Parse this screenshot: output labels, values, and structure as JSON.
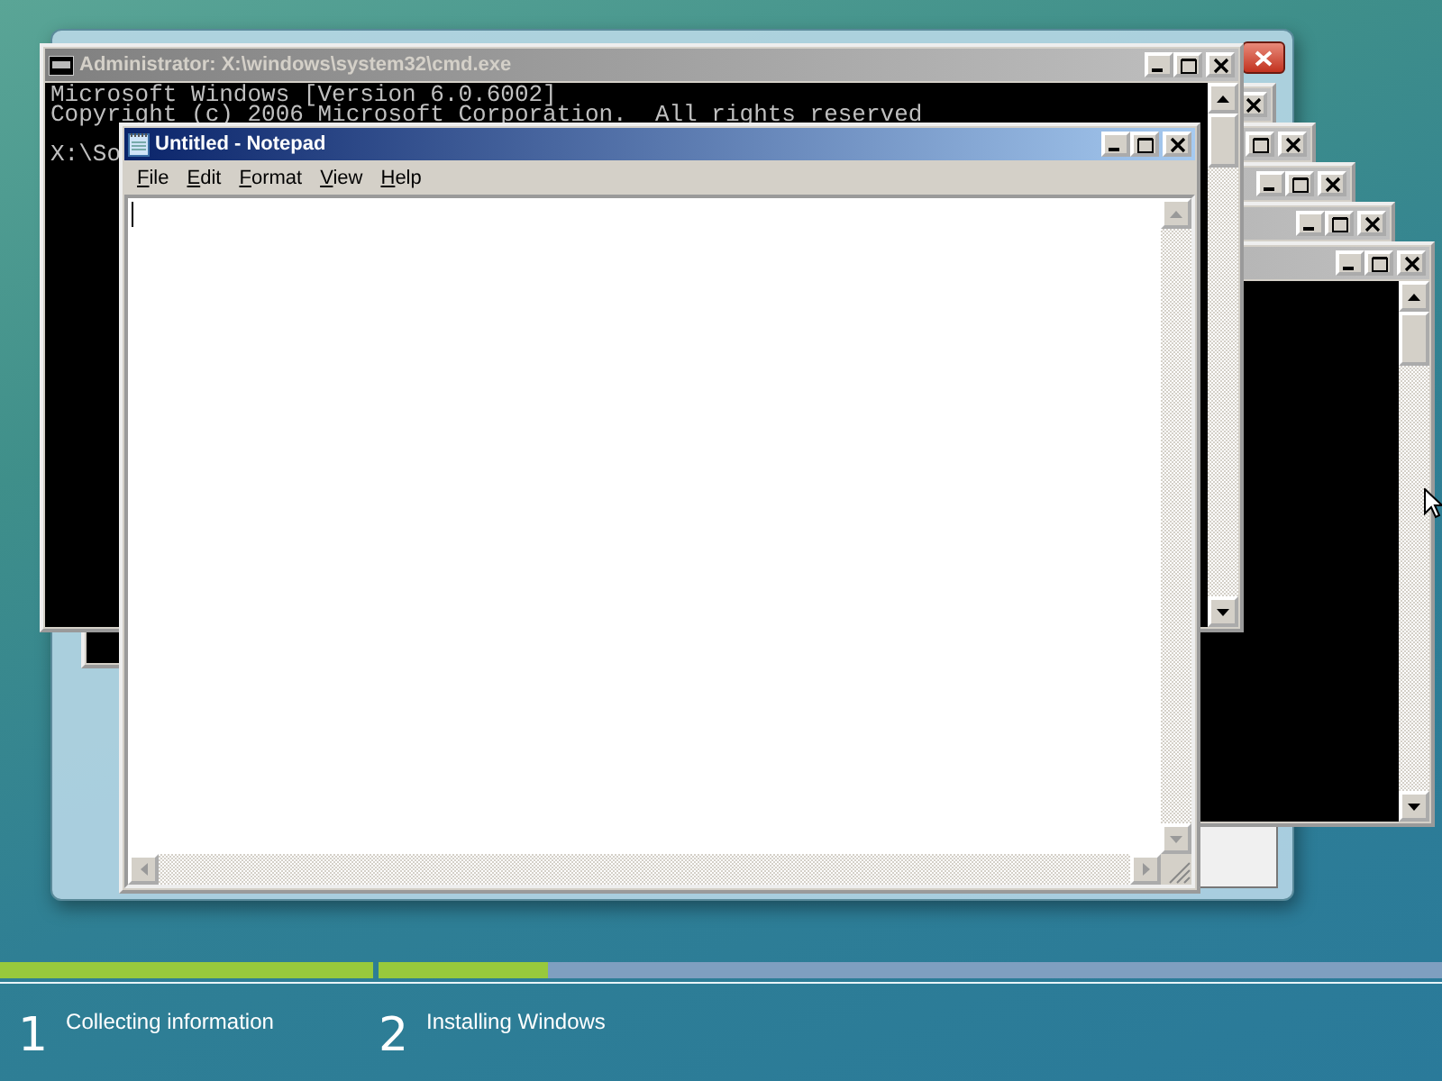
{
  "command_window": {
    "title": "Administrator: X:\\windows\\system32\\cmd.exe",
    "lines": [
      "Microsoft Windows [Version 6.0.6002]",
      "Copyright (c) 2006 Microsoft Corporation.  All rights reserved",
      "X:\\So"
    ]
  },
  "notepad": {
    "title": "Untitled - Notepad",
    "menu": [
      {
        "label": "File"
      },
      {
        "label": "Edit"
      },
      {
        "label": "Format"
      },
      {
        "label": "View"
      },
      {
        "label": "Help"
      }
    ]
  },
  "steps": [
    {
      "number": "1",
      "label": "Collecting information",
      "level": 1
    },
    {
      "number": "2",
      "label": "Installing Windows",
      "level": 0.16
    }
  ]
}
